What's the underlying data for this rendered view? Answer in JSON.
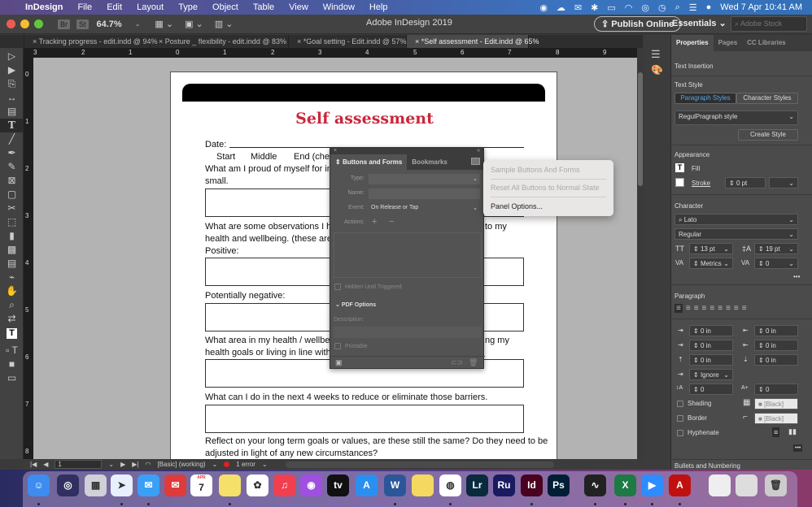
{
  "menubar": {
    "app_name": "InDesign",
    "items": [
      "File",
      "Edit",
      "Layout",
      "Type",
      "Object",
      "Table",
      "View",
      "Window",
      "Help"
    ],
    "clock": "Wed 7 Apr  10:41 AM"
  },
  "appbar": {
    "bridge": "Br",
    "stock": "St",
    "zoom": "64.7%",
    "window_title": "Adobe InDesign 2019",
    "publish_label": "Publish Online",
    "workspace": "Essentials",
    "stock_search_placeholder": "Adobe Stock"
  },
  "tabs": [
    {
      "label": "Tracking progress - edit.indd @ 94%"
    },
    {
      "label": "Posture _ flexibility - edit.indd @ 83%"
    },
    {
      "label": "*Goal setting - Edit.indd @ 57%"
    },
    {
      "label": "*Self assessment - Edit.indd @ 65%"
    }
  ],
  "ruler": {
    "top": [
      "3",
      "2",
      "1",
      "0",
      "1",
      "2",
      "3",
      "4",
      "5",
      "6",
      "7",
      "8",
      "9"
    ],
    "left": [
      "0",
      "1",
      "2",
      "3",
      "4",
      "5",
      "6",
      "7",
      "8"
    ]
  },
  "document": {
    "title": "Self assessment",
    "date_label": "Date:",
    "stages": [
      "Start",
      "Middle",
      "End (chec"
    ],
    "q1": "What am I proud of myself for in t",
    "q1b": "small.",
    "q2": "What are some observations I hav",
    "q2_tail": "to my",
    "q2b": "health and wellbeing. (these are th",
    "positive": "Positive:",
    "negative": "Potentially negative:",
    "q3": "What area in my health / wellbein",
    "q3_tail": "ng my",
    "q3b": "health goals or living in line with m",
    "q4": "What can I do in the next 4 weeks to reduce or eliminate those barriers.",
    "q5": "Reflect on your long term goals or values, are these still the same? Do they need to be",
    "q5b": "adjusted in light of any new circumstances?",
    "accent_color": "#c8283c"
  },
  "buttons_forms_panel": {
    "tab_active": "Buttons and Forms",
    "tab_other": "Bookmarks",
    "type_label": "Type:",
    "type_value": "",
    "name_label": "Name:",
    "name_value": "",
    "event_label": "Event:",
    "event_value": "On Release or Tap",
    "actions_label": "Actions:",
    "hidden_label": "Hidden Until Triggered",
    "pdf_options": "PDF Options",
    "description_label": "Description:",
    "printable_label": "Printable"
  },
  "flyout_menu": {
    "items": [
      {
        "label": "Sample Buttons And Forms",
        "enabled": false
      },
      {
        "label": "Reset All Buttons to Normal State",
        "enabled": false
      },
      {
        "label": "Panel Options...",
        "enabled": true
      }
    ]
  },
  "status": {
    "page": "1",
    "preflight_profile": "[Basic] (working)",
    "errors": "1 error"
  },
  "properties": {
    "tabs": [
      "Properties",
      "Pages",
      "CC Libraries"
    ],
    "text_insertion": "Text Insertion",
    "text_style": "Text Style",
    "para_styles": "Paragraph Styles",
    "char_styles": "Character Styles",
    "style_value": "RegulPragraph style",
    "create_style": "Create Style",
    "appearance": "Appearance",
    "fill": "Fill",
    "stroke": "Stroke",
    "stroke_weight": "0 pt",
    "character": "Character",
    "font": "Lato",
    "font_style": "Regular",
    "font_size": "13 pt",
    "leading": "19 pt",
    "kerning": "Metrics",
    "tracking": "0",
    "paragraph": "Paragraph",
    "left_indent": "0 in",
    "right_indent": "0 in",
    "first_line_indent": "0 in",
    "last_line_indent": "0 in",
    "space_before": "0 in",
    "space_after": "0 in",
    "align_grid": "Ignore",
    "drop_cap_lines": "0",
    "drop_cap_chars": "0",
    "shading": "Shading",
    "shading_color": "[Black]",
    "border": "Border",
    "border_color": "[Black]",
    "hyphenate": "Hyphenate",
    "bullets": "Bullets and Numbering"
  },
  "dock": {
    "apps": [
      "Finder",
      "Siri",
      "Launchpad",
      "Safari",
      "Mail",
      "Airmail",
      "Calendar",
      "Notes",
      "Photos",
      "Music",
      "Podcasts",
      "TV",
      "App Store",
      "Word",
      "Stickies",
      "Chrome",
      "Lightroom",
      "Rush",
      "InDesign",
      "Photoshop",
      "Activity Monitor",
      "Excel",
      "Zoom",
      "Acrobat",
      "Document",
      "Preview",
      "Trash"
    ],
    "calendar_month": "APR",
    "calendar_day": "7"
  }
}
